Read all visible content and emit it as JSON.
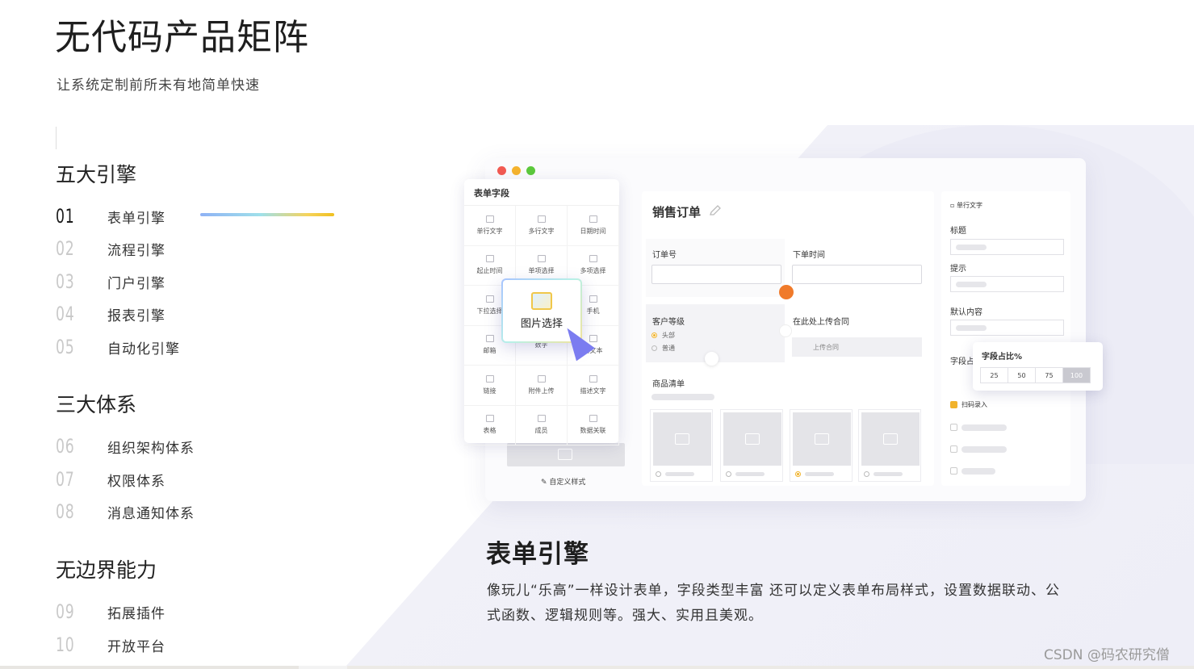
{
  "hero": {
    "title": "无代码产品矩阵",
    "subtitle": "让系统定制前所未有地简单快速"
  },
  "groups": [
    {
      "title": "五大引擎",
      "items": [
        {
          "num": "01",
          "label": "表单引擎"
        },
        {
          "num": "02",
          "label": "流程引擎"
        },
        {
          "num": "03",
          "label": "门户引擎"
        },
        {
          "num": "04",
          "label": "报表引擎"
        },
        {
          "num": "05",
          "label": "自动化引擎"
        }
      ]
    },
    {
      "title": "三大体系",
      "items": [
        {
          "num": "06",
          "label": "组织架构体系"
        },
        {
          "num": "07",
          "label": "权限体系"
        },
        {
          "num": "08",
          "label": "消息通知体系"
        }
      ]
    },
    {
      "title": "无边界能力",
      "items": [
        {
          "num": "09",
          "label": "拓展插件"
        },
        {
          "num": "10",
          "label": "开放平台"
        }
      ]
    }
  ],
  "active_item": "01",
  "colors": {
    "dot_red": "#f25a52",
    "dot_yellow": "#f5b32e",
    "dot_green": "#5cc93c",
    "accent": "#f1b32c",
    "cursor": "#7b7cf0",
    "trash": "#f07a2a"
  },
  "mock": {
    "fields_panel": {
      "title": "表单字段",
      "fields": [
        "单行文字",
        "多行文字",
        "日期时间",
        "起止时间",
        "单项选择",
        "多项选择",
        "下拉选择",
        "",
        "手机",
        "邮箱",
        "数字",
        "富文本",
        "链接",
        "附件上传",
        "描述文字",
        "表格",
        "成员",
        "数据关联"
      ],
      "drag_item": "图片选择",
      "custom_style": "自定义样式"
    },
    "form": {
      "title": "销售订单",
      "order_no_label": "订单号",
      "order_time_label": "下单时间",
      "customer_level_label": "客户等级",
      "level_options": [
        "头部",
        "普通"
      ],
      "contract_label": "在此处上传合同",
      "upload_label": "上传合同",
      "goods_label": "商品清单"
    },
    "props": {
      "field_type": "单行文字",
      "title_label": "标题",
      "hint_label": "提示",
      "default_label": "默认内容",
      "width_label": "字段占",
      "popup_title": "字段占比%",
      "width_options": [
        "25",
        "50",
        "75",
        "100"
      ],
      "width_selected": "100",
      "scan_label": "扫码录入"
    }
  },
  "description": {
    "title": "表单引擎",
    "body": "像玩儿“乐高”一样设计表单，字段类型丰富 还可以定义表单布局样式，设置数据联动、公式函数、逻辑规则等。强大、实用且美观。"
  },
  "watermark": "CSDN @码农研究僧"
}
